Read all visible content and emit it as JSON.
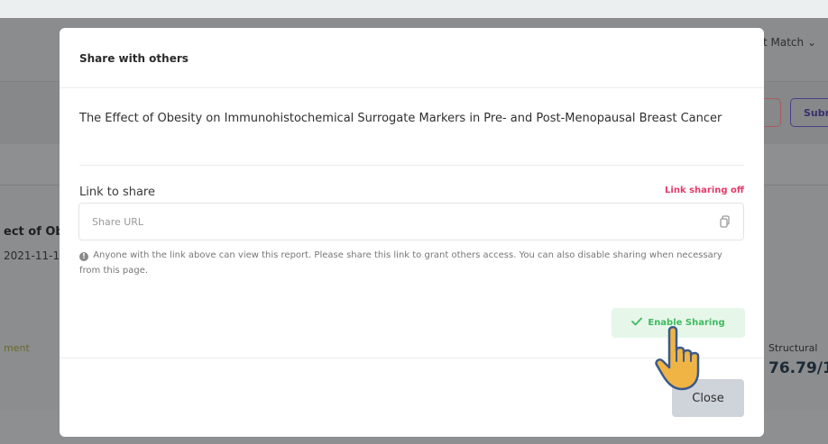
{
  "background": {
    "sort_label": "t Match",
    "submit_label": "Subr",
    "report_title_fragment": "ect of Ob",
    "report_date_fragment": "2021-11-1",
    "tab_fragment": "ment",
    "score_label": "Structural",
    "score_value": "76.79/1"
  },
  "modal": {
    "title": "Share with others",
    "report_title": "The Effect of Obesity on Immunohistochemical Surrogate Markers in Pre- and Post-Menopausal Breast Cancer",
    "link_label": "Link to share",
    "link_status": "Link sharing off",
    "url_placeholder": "Share URL",
    "url_value": "",
    "note": "Anyone with the link above can view this report. Please share this link to grant others access. You can also disable sharing when necessary from this page.",
    "enable_label": "Enable Sharing",
    "close_label": "Close"
  },
  "colors": {
    "link_status": "#e53a6a",
    "enable_text": "#3fba5f",
    "enable_bg": "#e6f7ea",
    "close_bg": "#cfd3da"
  },
  "icons": [
    "copy-icon",
    "info-icon",
    "check-icon",
    "pointer-hand-icon",
    "chevron-down-icon"
  ]
}
